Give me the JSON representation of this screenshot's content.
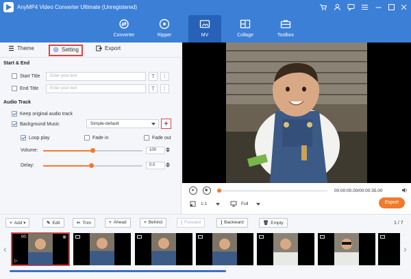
{
  "app": {
    "title": "AnyMP4 Video Converter Ultimate (Unregistered)"
  },
  "nav": {
    "items": [
      {
        "label": "Converter",
        "icon": "converter-icon"
      },
      {
        "label": "Ripper",
        "icon": "ripper-icon"
      },
      {
        "label": "MV",
        "icon": "mv-icon",
        "active": true
      },
      {
        "label": "Collage",
        "icon": "collage-icon"
      },
      {
        "label": "Toolbox",
        "icon": "toolbox-icon"
      }
    ]
  },
  "tabs": {
    "theme": "Theme",
    "setting": "Setting",
    "export": "Export"
  },
  "start_end": {
    "heading": "Start & End",
    "start_title_label": "Start Title",
    "start_title_placeholder": "Enter your text",
    "end_title_label": "End Title",
    "end_title_placeholder": "Enter your text"
  },
  "audio": {
    "heading": "Audio Track",
    "keep_original": "Keep original audio track",
    "background_music": "Background Music",
    "music_selected": "Simple-default",
    "add_symbol": "+",
    "loop_play": "Loop play",
    "fade_in": "Fade in",
    "fade_out": "Fade out",
    "volume_label": "Volume:",
    "volume_value": "100",
    "delay_label": "Delay:",
    "delay_value": "0.0"
  },
  "player": {
    "timecode": "00:00:00.00/00:00:35.00",
    "ratio": "1:1",
    "display": "Full",
    "export_label": "Export"
  },
  "toolbar": {
    "add": "Add",
    "edit": "Edit",
    "trim": "Trim",
    "ahead": "Ahead",
    "behind": "Behind",
    "forward": "Forward",
    "backward": "Backward",
    "empty": "Empty",
    "page": "1 / 7"
  },
  "filmstrip": {
    "first_clip_time": "00:"
  },
  "colors": {
    "accent": "#3c7fd6",
    "highlight": "#e24040",
    "orange": "#f07a2e"
  }
}
